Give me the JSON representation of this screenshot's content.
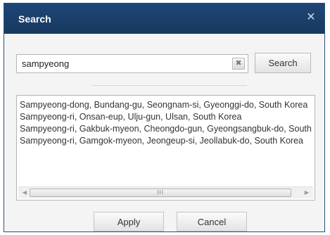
{
  "dialog": {
    "title": "Search",
    "close_icon": "close-icon"
  },
  "search": {
    "value": "sampyeong",
    "placeholder": "",
    "clear_icon": "clear-icon",
    "button_label": "Search"
  },
  "results": {
    "items": [
      "Sampyeong-dong, Bundang-gu, Seongnam-si, Gyeonggi-do, South Korea",
      "Sampyeong-ri, Onsan-eup, Ulju-gun, Ulsan, South Korea",
      "Sampyeong-ri, Gakbuk-myeon, Cheongdo-gun, Gyeongsangbuk-do, South Korea",
      "Sampyeong-ri, Gamgok-myeon, Jeongeup-si, Jeollabuk-do, South Korea"
    ],
    "scrollbar_grip": "III"
  },
  "footer": {
    "apply_label": "Apply",
    "cancel_label": "Cancel"
  },
  "colors": {
    "titlebar": "#1f4676",
    "dialog_bg": "#f4f4f4"
  }
}
